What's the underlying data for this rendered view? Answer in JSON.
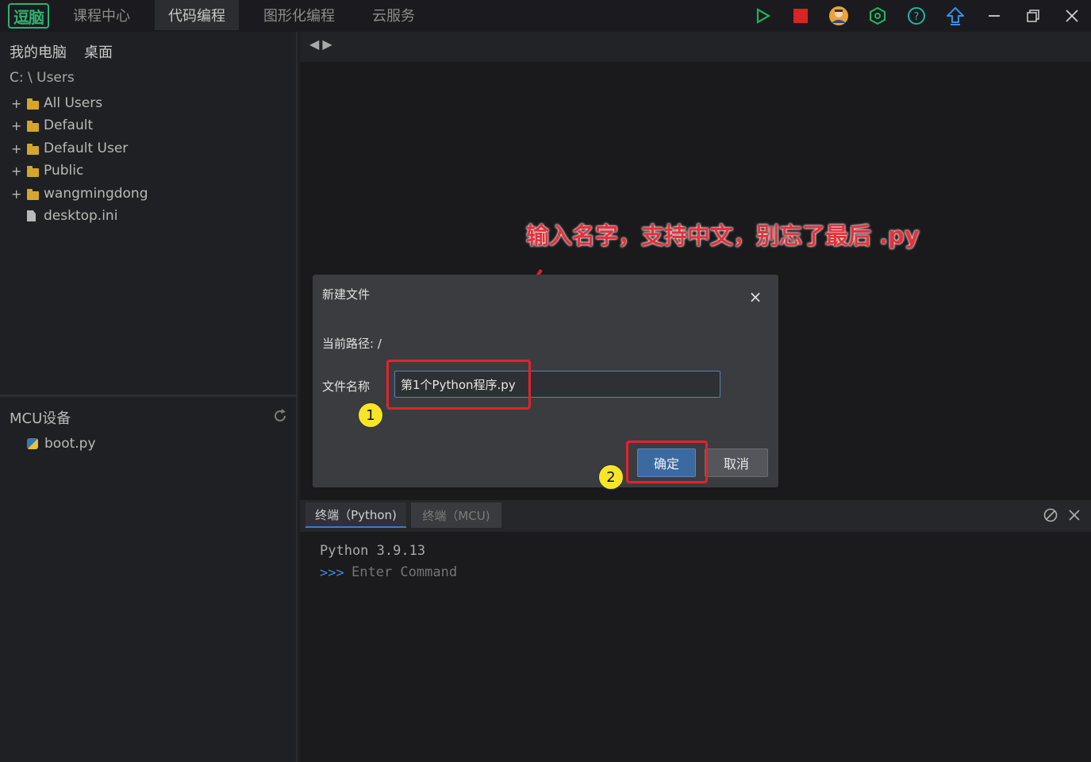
{
  "app": {
    "logo_text": "逗脑",
    "tabs": [
      {
        "label": "课程中心",
        "active": false
      },
      {
        "label": "代码编程",
        "active": true
      },
      {
        "label": "图形化编程",
        "active": false
      },
      {
        "label": "云服务",
        "active": false
      }
    ],
    "toolbar_icons": [
      "run-icon",
      "stop-icon",
      "user-avatar-icon",
      "hex-settings-icon",
      "help-icon",
      "upload-icon",
      "minimize-icon",
      "restore-icon",
      "close-icon"
    ],
    "colors": {
      "run": "#21b05a",
      "stop": "#d92424",
      "help": "#1fb3a8",
      "upload": "#3a8fe6",
      "accent": "#3b6aa0",
      "highlight": "#e5222c",
      "badge": "#f7e52a"
    }
  },
  "file_panel": {
    "tabs": [
      "我的电脑",
      "桌面"
    ],
    "path": "C: \\ Users",
    "items": [
      {
        "label": "All Users",
        "type": "folder"
      },
      {
        "label": "Default",
        "type": "folder"
      },
      {
        "label": "Default User",
        "type": "folder"
      },
      {
        "label": "Public",
        "type": "folder"
      },
      {
        "label": "wangmingdong",
        "type": "folder"
      },
      {
        "label": "desktop.ini",
        "type": "file"
      }
    ]
  },
  "mcu_panel": {
    "title": "MCU设备",
    "files": [
      {
        "label": "boot.py",
        "type": "python"
      }
    ]
  },
  "annotation": {
    "text": "输入名字，支持中文，别忘了最后 .py",
    "badge1": "1",
    "badge2": "2"
  },
  "dialog": {
    "title": "新建文件",
    "close_glyph": "×",
    "path_label": "当前路径: /",
    "name_label": "文件名称",
    "name_value": "第1个Python程序.py",
    "ok_label": "确定",
    "cancel_label": "取消"
  },
  "terminal": {
    "tabs": [
      {
        "label": "终端（Python)",
        "active": true
      },
      {
        "label": "终端（MCU)",
        "active": false
      }
    ],
    "version_line": "Python 3.9.13",
    "prompt": ">>>",
    "placeholder": "Enter Command"
  }
}
